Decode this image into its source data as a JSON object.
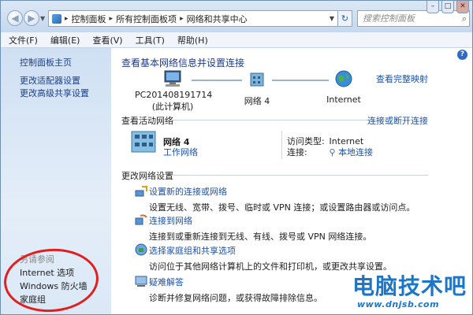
{
  "address_bar": {
    "crumbs": [
      "控制面板",
      "所有控制面板项",
      "网络和共享中心"
    ],
    "search_placeholder": "搜索控制面板"
  },
  "menu": [
    "文件(F)",
    "编辑(E)",
    "查看(V)",
    "工具(T)",
    "帮助(H)"
  ],
  "sidebar": {
    "home": "控制面板主页",
    "items": [
      "更改适配器设置",
      "更改高级共享设置"
    ],
    "see_also_title": "另请参阅",
    "see_also": [
      "Internet 选项",
      "Windows 防火墙",
      "家庭组"
    ]
  },
  "main": {
    "title": "查看基本网络信息并设置连接",
    "full_map": "查看完整映射",
    "nodes": [
      {
        "name": "PC201408191714",
        "sub": "(此计算机)"
      },
      {
        "name": "网络  4",
        "sub": ""
      },
      {
        "name": "Internet",
        "sub": ""
      }
    ],
    "active_title": "查看活动网络",
    "connect_link": "连接或断开连接",
    "network_name": "网络  4",
    "network_type": "工作网络",
    "access_type_label": "访问类型:",
    "access_type_value": "Internet",
    "connection_label": "连接:",
    "connection_value": "本地连接",
    "change_title": "更改网络设置",
    "tasks": [
      {
        "title": "设置新的连接或网络",
        "desc": "设置无线、宽带、拨号、临时或 VPN 连接；或设置路由器或访问点。"
      },
      {
        "title": "连接到网络",
        "desc": "连接到或重新连接到无线、有线、拨号或 VPN 网络连接。"
      },
      {
        "title": "选择家庭组和共享选项",
        "desc": "访问位于其他网络计算机上的文件和打印机，或更改共享设置。"
      },
      {
        "title": "疑难解答",
        "desc": "诊断并修复网络问题，或获得故障排除信息。"
      }
    ]
  },
  "watermark": {
    "text": "电脑技术吧",
    "url": "www.dnjsb.com"
  }
}
